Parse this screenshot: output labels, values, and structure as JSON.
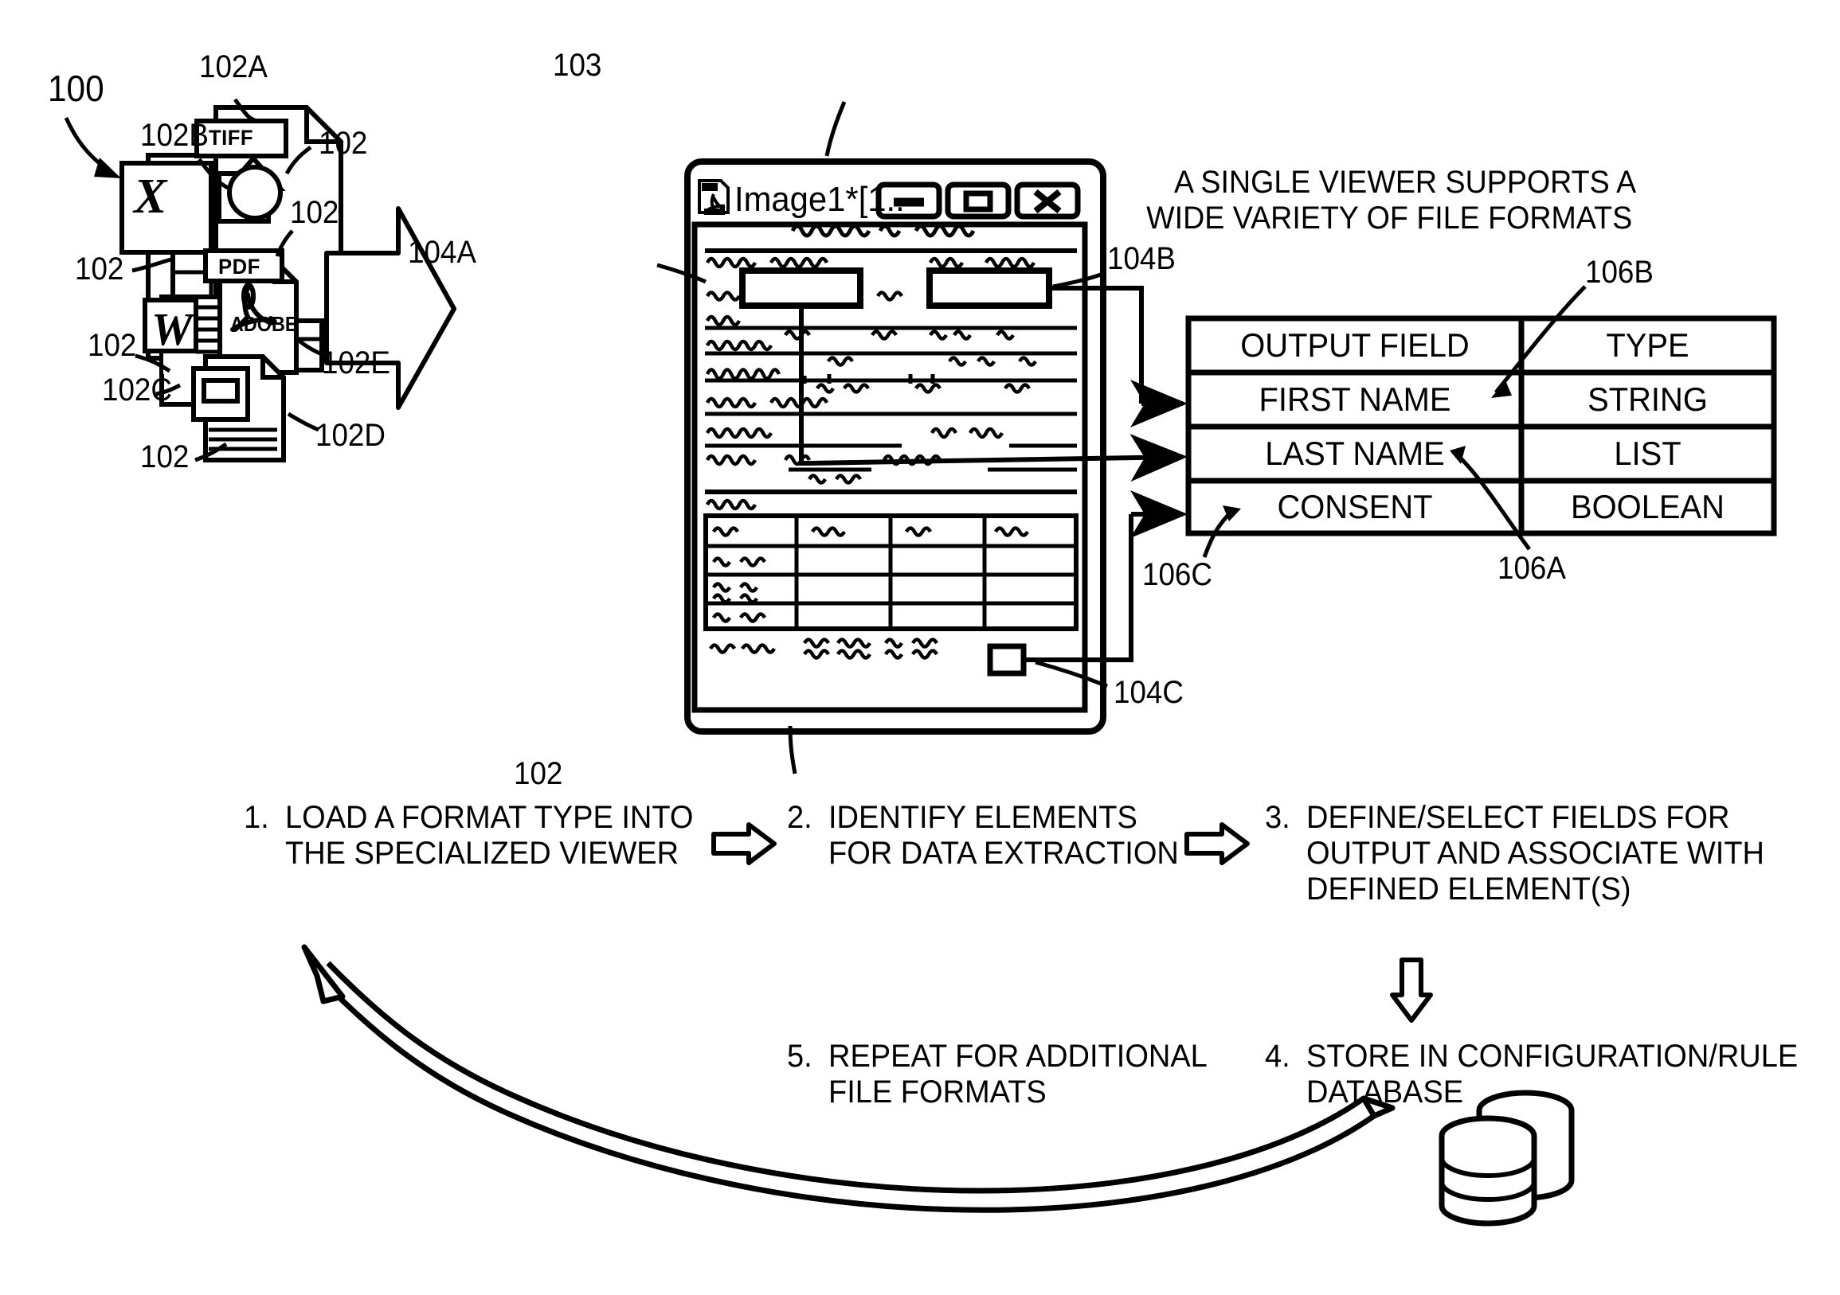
{
  "figure": {
    "number": "100",
    "caption_right": "A SINGLE VIEWER SUPPORTS A\nWIDE VARIETY OF FILE FORMATS"
  },
  "reference_numerals": {
    "fig": "100",
    "tiff_doc": "102A",
    "excel_doc": "102B",
    "word_doc": "102C",
    "slide_doc": "102D",
    "pdf_doc": "102E",
    "generic_doc_1": "102",
    "generic_doc_2": "102",
    "generic_doc_3": "102",
    "generic_doc_4": "102",
    "generic_doc_5": "102",
    "viewer_window": "103",
    "viewer_document": "102",
    "element_first": "104A",
    "element_last": "104B",
    "element_consent": "104C",
    "field_type_col": "106A",
    "field_header": "106B",
    "field_name_col": "106C"
  },
  "file_icons": {
    "tiff_label": "TIFF",
    "pdf_label": "PDF",
    "adobe_label": "ADOBE",
    "excel_glyph": "X",
    "word_glyph": "W"
  },
  "viewer": {
    "title": "Image1*[1..",
    "app_icon": "pdf-document-icon",
    "buttons": [
      {
        "name": "minimize-button",
        "glyph": "minimize"
      },
      {
        "name": "maximize-button",
        "glyph": "maximize"
      },
      {
        "name": "close-button",
        "glyph": "close"
      }
    ]
  },
  "output_table": {
    "headers": [
      "OUTPUT FIELD",
      "TYPE"
    ],
    "rows": [
      {
        "field": "FIRST NAME",
        "type": "STRING"
      },
      {
        "field": "LAST NAME",
        "type": "LIST"
      },
      {
        "field": "CONSENT",
        "type": "BOOLEAN"
      }
    ]
  },
  "steps": [
    {
      "num": "1.",
      "text": "LOAD A FORMAT TYPE INTO\nTHE SPECIALIZED VIEWER"
    },
    {
      "num": "2.",
      "text": "IDENTIFY ELEMENTS\nFOR DATA EXTRACTION"
    },
    {
      "num": "3.",
      "text": "DEFINE/SELECT FIELDS FOR\nOUTPUT AND ASSOCIATE WITH\nDEFINED ELEMENT(S)"
    },
    {
      "num": "4.",
      "text": "STORE IN CONFIGURATION/RULE\nDATABASE"
    },
    {
      "num": "5.",
      "text": "REPEAT FOR ADDITIONAL\nFILE FORMATS"
    }
  ],
  "colors": {
    "ink": "#000000",
    "paper": "#ffffff"
  }
}
